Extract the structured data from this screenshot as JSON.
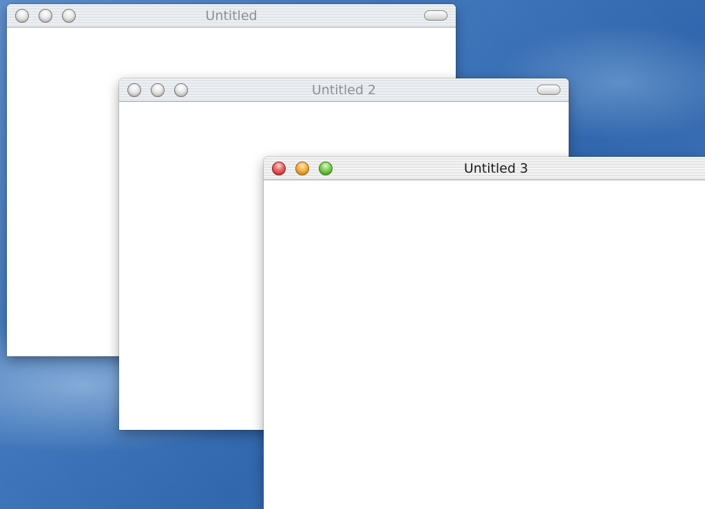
{
  "desktop": {
    "background_color": "#3a70b6"
  },
  "windows": [
    {
      "title": "Untitled",
      "state": "inactive",
      "controls": [
        "close-button",
        "minimize-button",
        "zoom-button"
      ],
      "has_toolbar_toggle": true
    },
    {
      "title": "Untitled 2",
      "state": "inactive",
      "controls": [
        "close-button",
        "minimize-button",
        "zoom-button"
      ],
      "has_toolbar_toggle": true
    },
    {
      "title": "Untitled 3",
      "state": "active",
      "controls": [
        "close-button",
        "minimize-button",
        "zoom-button"
      ],
      "control_colors": {
        "close": "#e04b4b",
        "minimize": "#f5a623",
        "zoom": "#6cc13f"
      },
      "has_toolbar_toggle": false
    }
  ]
}
